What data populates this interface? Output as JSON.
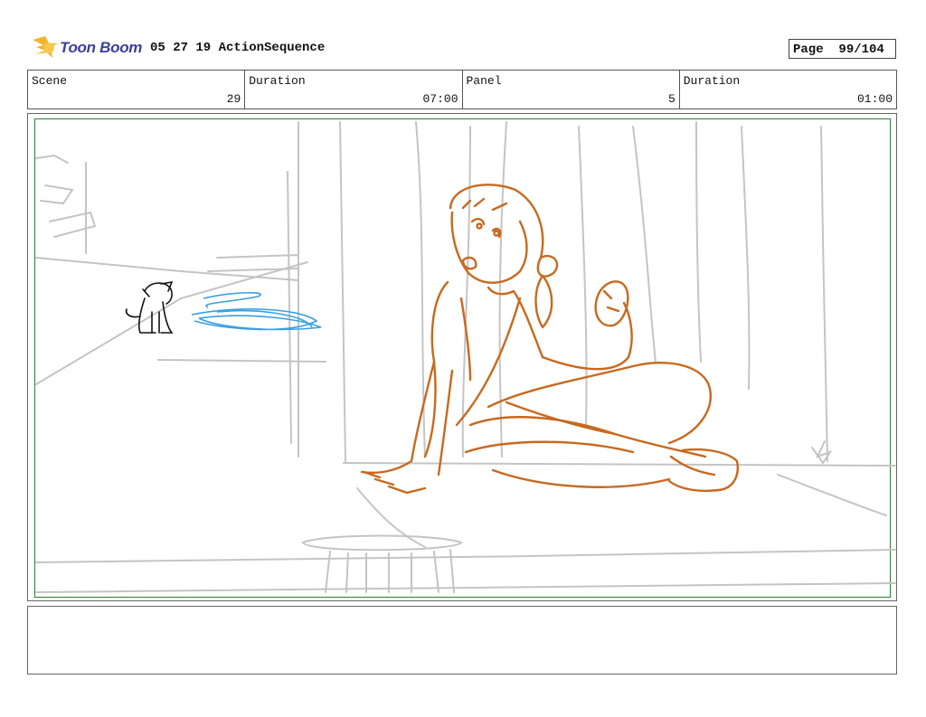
{
  "header": {
    "logo_text": "Toon Boom",
    "title": "05 27 19 ActionSequence",
    "page_label": "Page",
    "page_value": "99/104"
  },
  "info": {
    "scene_label": "Scene",
    "scene_value": "29",
    "duration_label": "Duration",
    "duration_value": "07:00",
    "panel_label": "Panel",
    "panel_value": "5",
    "panel_duration_label": "Duration",
    "panel_duration_value": "01:00"
  },
  "notes": {
    "text": ""
  },
  "colors": {
    "character_lines": "#c8691e",
    "effect_lines": "#3aa0e0",
    "background_lines": "#c4c4c4",
    "safe_frame": "#2e7d32",
    "logo_blue": "#3a3f9a",
    "logo_star": "#f2b42a"
  }
}
